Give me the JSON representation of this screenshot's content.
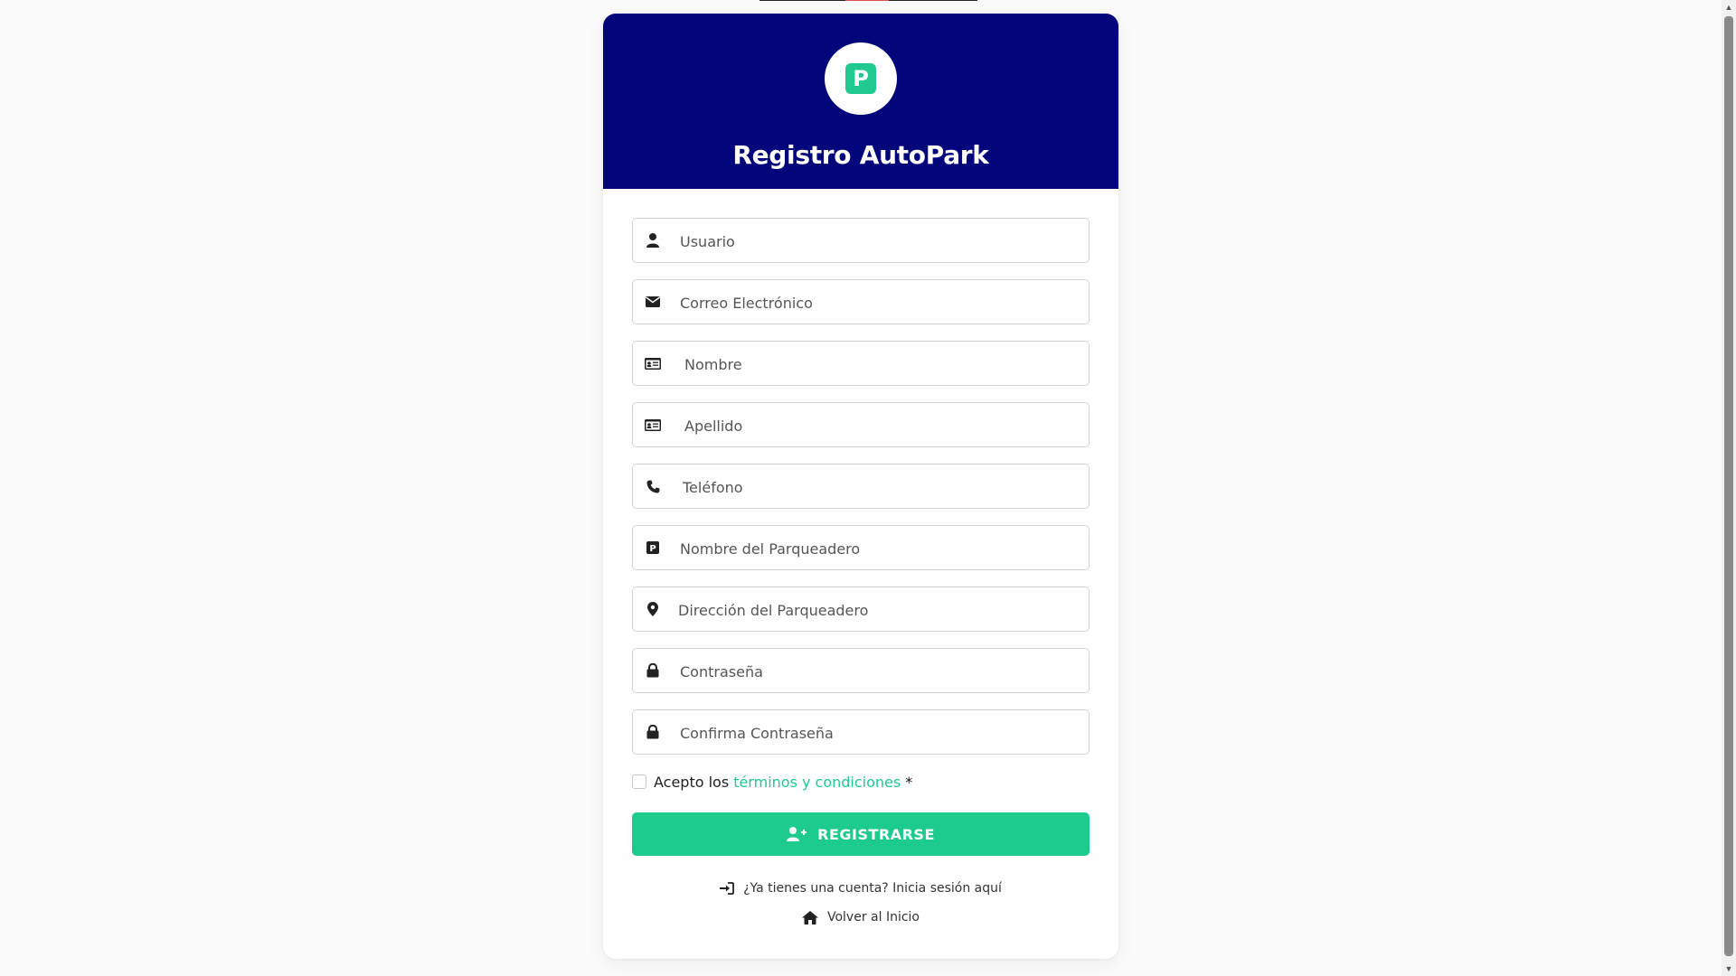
{
  "header": {
    "title": "Registro AutoPark",
    "logo_letter": "P"
  },
  "form": {
    "fields": [
      {
        "name": "usuario",
        "placeholder": "Usuario",
        "icon": "user-icon"
      },
      {
        "name": "correo",
        "placeholder": "Correo Electrónico",
        "icon": "envelope-icon"
      },
      {
        "name": "nombre",
        "placeholder": "Nombre",
        "icon": "id-card-icon"
      },
      {
        "name": "apellido",
        "placeholder": "Apellido",
        "icon": "id-card-icon"
      },
      {
        "name": "telefono",
        "placeholder": "Teléfono",
        "icon": "phone-icon"
      },
      {
        "name": "parqueadero",
        "placeholder": "Nombre del Parqueadero",
        "icon": "parking-icon"
      },
      {
        "name": "direccion",
        "placeholder": "Dirección del Parqueadero",
        "icon": "map-marker-icon"
      },
      {
        "name": "password",
        "placeholder": "Contraseña",
        "icon": "lock-icon"
      },
      {
        "name": "confirm-password",
        "placeholder": "Confirma Contraseña",
        "icon": "lock-icon"
      }
    ],
    "terms": {
      "prefix": "Acepto los",
      "link": "términos y condiciones",
      "required_mark": "*"
    },
    "submit_label": "REGISTRARSE"
  },
  "links": {
    "login": "¿Ya tienes una cuenta? Inicia sesión aquí",
    "home": "Volver al Inicio"
  },
  "colors": {
    "header_bg": "#03067a",
    "accent": "#1dcb8d"
  }
}
